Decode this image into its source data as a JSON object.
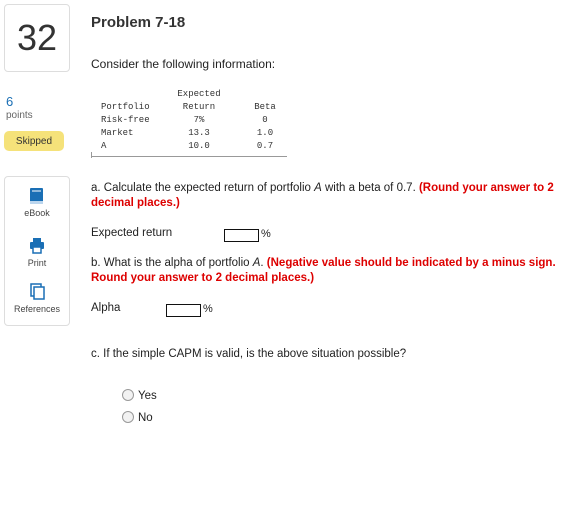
{
  "question_number": "32",
  "points_value": "6",
  "points_label": "points",
  "status_badge": "Skipped",
  "tools": {
    "ebook": "eBook",
    "print": "Print",
    "references": "References"
  },
  "problem_title": "Problem 7-18",
  "intro": "Consider the following information:",
  "table": {
    "header_top": "Expected",
    "headers": [
      "Portfolio",
      "Return",
      "Beta"
    ],
    "rows": [
      [
        "Risk-free",
        "7%",
        "0"
      ],
      [
        "Market",
        "13.3",
        "1.0"
      ],
      [
        "A",
        "10.0",
        "0.7"
      ]
    ]
  },
  "part_a": {
    "question_prefix": "a. Calculate the expected return of portfolio ",
    "question_italic": "A",
    "question_suffix": " with a beta of 0.7. ",
    "instruction": "(Round your answer to 2 decimal places.)",
    "label": "Expected return",
    "value": "",
    "unit": "%"
  },
  "part_b": {
    "question_prefix": "b. What is the alpha of portfolio ",
    "question_italic": "A",
    "question_suffix": ". ",
    "instruction": "(Negative value should be indicated by a minus sign. Round your answer to 2 decimal places.)",
    "label": "Alpha",
    "value": "",
    "unit": "%"
  },
  "part_c": {
    "question": "c. If the simple CAPM is valid, is the above situation possible?",
    "options": [
      "Yes",
      "No"
    ]
  }
}
